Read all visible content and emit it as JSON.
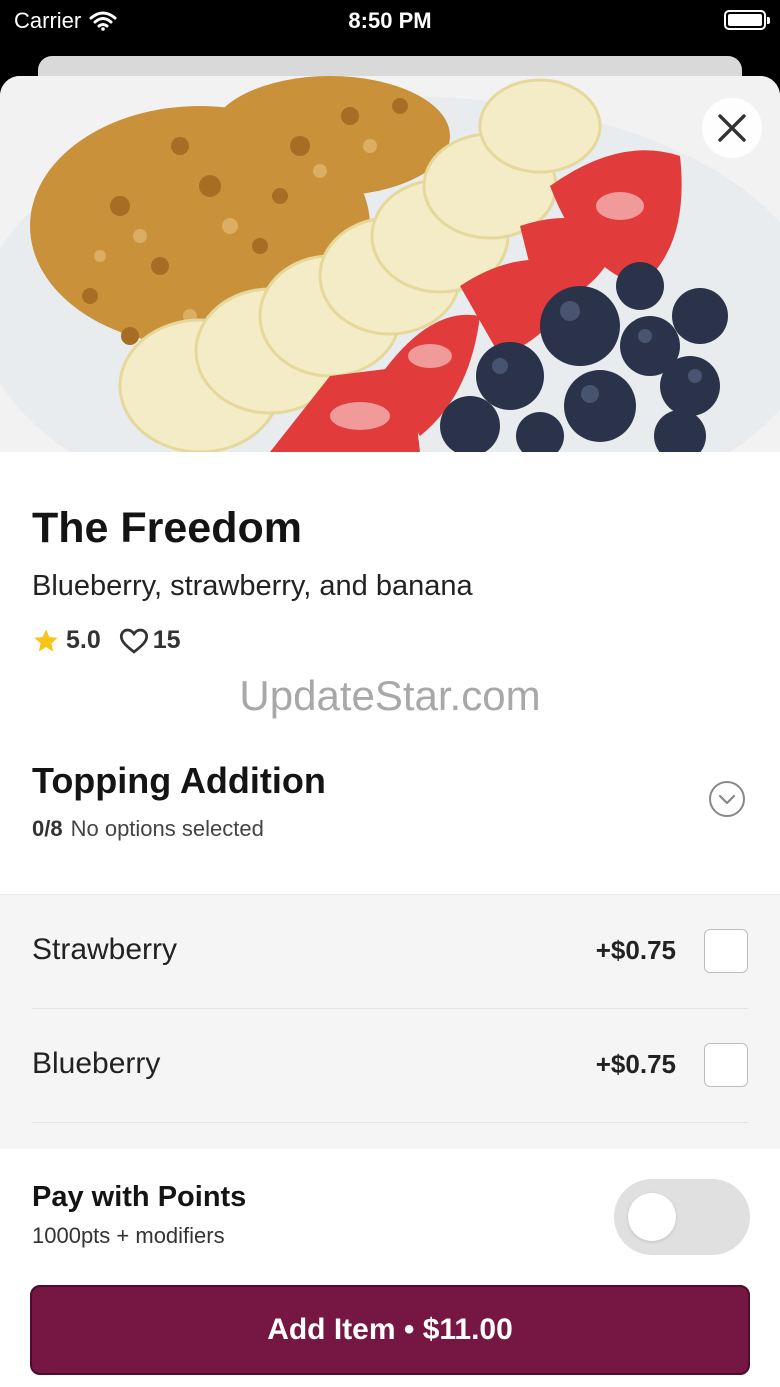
{
  "status_bar": {
    "carrier": "Carrier",
    "time": "8:50 PM"
  },
  "item": {
    "name": "The Freedom",
    "description": "Blueberry, strawberry, and banana",
    "rating": "5.0",
    "likes": "15"
  },
  "watermark": "UpdateStar.com",
  "topping_section": {
    "title": "Topping Addition",
    "count": "0/8",
    "status": "No options selected",
    "options": [
      {
        "name": "Strawberry",
        "price": "+$0.75"
      },
      {
        "name": "Blueberry",
        "price": "+$0.75"
      }
    ]
  },
  "footer": {
    "pay_title": "Pay with Points",
    "pay_subtitle": "1000pts + modifiers",
    "add_button": "Add Item • $11.00"
  },
  "colors": {
    "brand": "#761643",
    "star": "#f5c518",
    "toggle_off": "#e0e0e0"
  },
  "icons": {
    "close": "close-icon",
    "star": "star-icon",
    "heart": "heart-icon",
    "chevron": "chevron-down-icon",
    "wifi": "wifi-icon",
    "battery": "battery-icon"
  }
}
